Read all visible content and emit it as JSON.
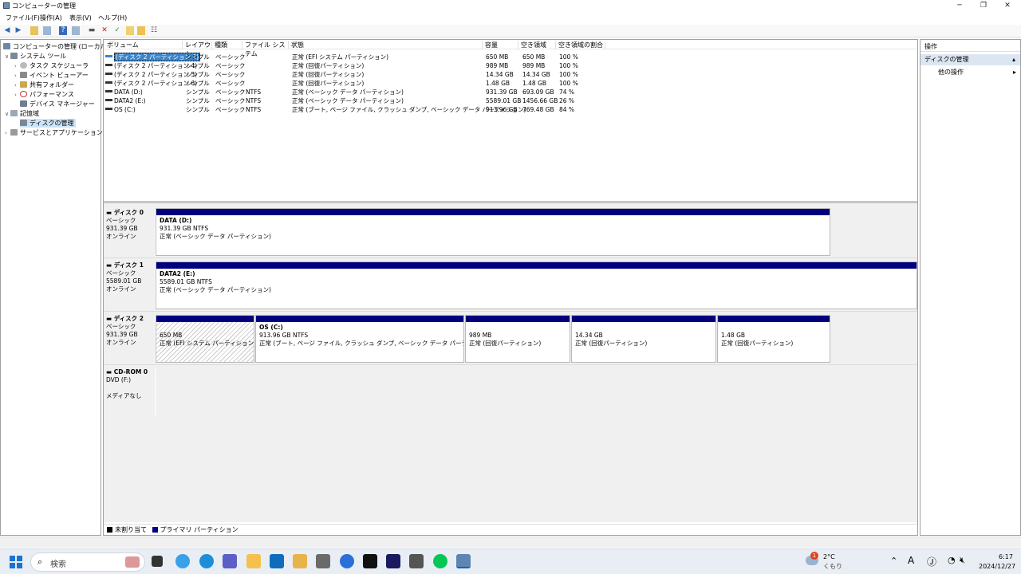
{
  "window": {
    "title": "コンピューターの管理"
  },
  "menu": [
    "ファイル(F)",
    "操作(A)",
    "表示(V)",
    "ヘルプ(H)"
  ],
  "tree": [
    {
      "label": "コンピューターの管理 (ローカル)",
      "expander": "",
      "icon": "computer-mgmt-icon"
    },
    {
      "label": "システム ツール",
      "expander": "∨",
      "icon": "tools-icon"
    },
    {
      "label": "タスク スケジューラ",
      "expander": "›",
      "icon": "clock-icon"
    },
    {
      "label": "イベント ビューアー",
      "expander": "›",
      "icon": "event-viewer-icon"
    },
    {
      "label": "共有フォルダー",
      "expander": "›",
      "icon": "shared-folder-icon"
    },
    {
      "label": "パフォーマンス",
      "expander": "›",
      "icon": "performance-icon"
    },
    {
      "label": "デバイス マネージャー",
      "expander": "",
      "icon": "device-manager-icon"
    },
    {
      "label": "記憶域",
      "expander": "∨",
      "icon": "storage-icon"
    },
    {
      "label": "ディスクの管理",
      "expander": "",
      "icon": "disk-management-icon"
    },
    {
      "label": "サービスとアプリケーション",
      "expander": "›",
      "icon": "services-icon"
    }
  ],
  "columns": [
    "ボリューム",
    "レイアウト",
    "種類",
    "ファイル システム",
    "状態",
    "容量",
    "空き領域",
    "空き領域の割合"
  ],
  "volumes": [
    [
      "(ディスク 2 パーティション 1)",
      "シンプル",
      "ベーシック",
      "",
      "正常 (EFI システム パーティション)",
      "650 MB",
      "650 MB",
      "100 %"
    ],
    [
      "(ディスク 2 パーティション 4)",
      "シンプル",
      "ベーシック",
      "",
      "正常 (回復パーティション)",
      "989 MB",
      "989 MB",
      "100 %"
    ],
    [
      "(ディスク 2 パーティション 5)",
      "シンプル",
      "ベーシック",
      "",
      "正常 (回復パーティション)",
      "14.34 GB",
      "14.34 GB",
      "100 %"
    ],
    [
      "(ディスク 2 パーティション 6)",
      "シンプル",
      "ベーシック",
      "",
      "正常 (回復パーティション)",
      "1.48 GB",
      "1.48 GB",
      "100 %"
    ],
    [
      "DATA (D:)",
      "シンプル",
      "ベーシック",
      "NTFS",
      "正常 (ベーシック データ パーティション)",
      "931.39 GB",
      "693.09 GB",
      "74 %"
    ],
    [
      "DATA2 (E:)",
      "シンプル",
      "ベーシック",
      "NTFS",
      "正常 (ベーシック データ パーティション)",
      "5589.01 GB",
      "1456.66 GB",
      "26 %"
    ],
    [
      "OS (C:)",
      "シンプル",
      "ベーシック",
      "NTFS",
      "正常 (ブート, ページ ファイル, クラッシュ ダンプ, ベーシック データ パーティション)",
      "913.96 GB",
      "769.48 GB",
      "84 %"
    ]
  ],
  "disks": [
    {
      "name": "ディスク 0",
      "type": "ベーシック",
      "size": "931.39 GB",
      "state": "オンライン",
      "partitions": [
        {
          "title": "DATA  (D:)",
          "line1": "931.39 GB NTFS",
          "line2": "正常 (ベーシック データ パーティション)"
        }
      ]
    },
    {
      "name": "ディスク 1",
      "type": "ベーシック",
      "size": "5589.01 GB",
      "state": "オンライン",
      "partitions": [
        {
          "title": "DATA2  (E:)",
          "line1": "5589.01 GB NTFS",
          "line2": "正常 (ベーシック データ パーティション)"
        }
      ]
    },
    {
      "name": "ディスク 2",
      "type": "ベーシック",
      "size": "931.39 GB",
      "state": "オンライン",
      "partitions": [
        {
          "title": "",
          "line1": "650 MB",
          "line2": "正常 (EFI システム パーティション)"
        },
        {
          "title": "OS  (C:)",
          "line1": "913.96 GB NTFS",
          "line2": "正常 (ブート, ページ ファイル, クラッシュ ダンプ, ベーシック データ パーティション)"
        },
        {
          "title": "",
          "line1": "989 MB",
          "line2": "正常 (回復パーティション)"
        },
        {
          "title": "",
          "line1": "14.34 GB",
          "line2": "正常 (回復パーティション)"
        },
        {
          "title": "",
          "line1": "1.48 GB",
          "line2": "正常 (回復パーティション)"
        }
      ]
    },
    {
      "name": "CD-ROM 0",
      "type": "DVD (F:)",
      "size": "",
      "state": "メディアなし",
      "partitions": []
    }
  ],
  "legend": [
    {
      "label": "未割り当て",
      "color": "#000000"
    },
    {
      "label": "プライマリ パーティション",
      "color": "#00007f"
    }
  ],
  "actions": {
    "header": "操作",
    "section": "ディスクの管理",
    "item": "他の操作"
  },
  "taskbar": {
    "search_placeholder": "検索",
    "weather_temp": "2°C",
    "weather_text": "くもり",
    "time": "6:17",
    "date": "2024/12/27",
    "ime": "A",
    "notification_count": "1"
  }
}
